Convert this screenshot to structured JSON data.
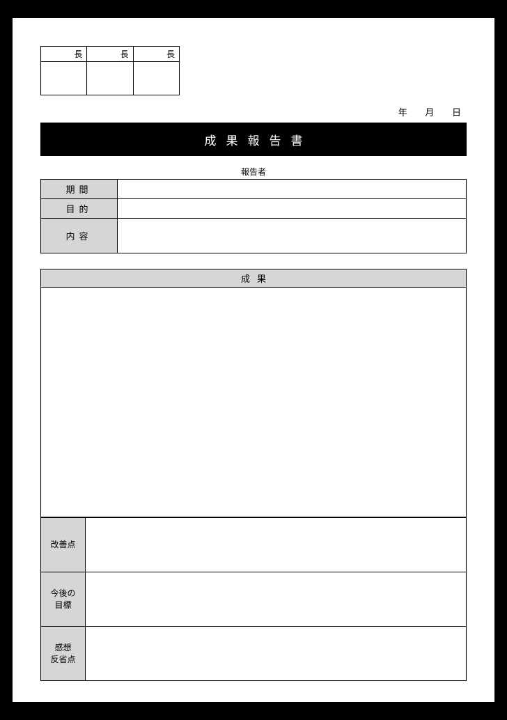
{
  "stamp": {
    "h1": "長",
    "h2": "長",
    "h3": "長"
  },
  "date": {
    "y": "年",
    "m": "月",
    "d": "日"
  },
  "title": "成果報告書",
  "reporter_label": "報告者",
  "info": {
    "period": "期間",
    "purpose": "目的",
    "content": "内容"
  },
  "result": {
    "header": "成果",
    "improve": "改善点",
    "future_l1": "今後の",
    "future_l2": "目標",
    "thoughts_l1": "感想",
    "thoughts_l2": "反省点"
  }
}
